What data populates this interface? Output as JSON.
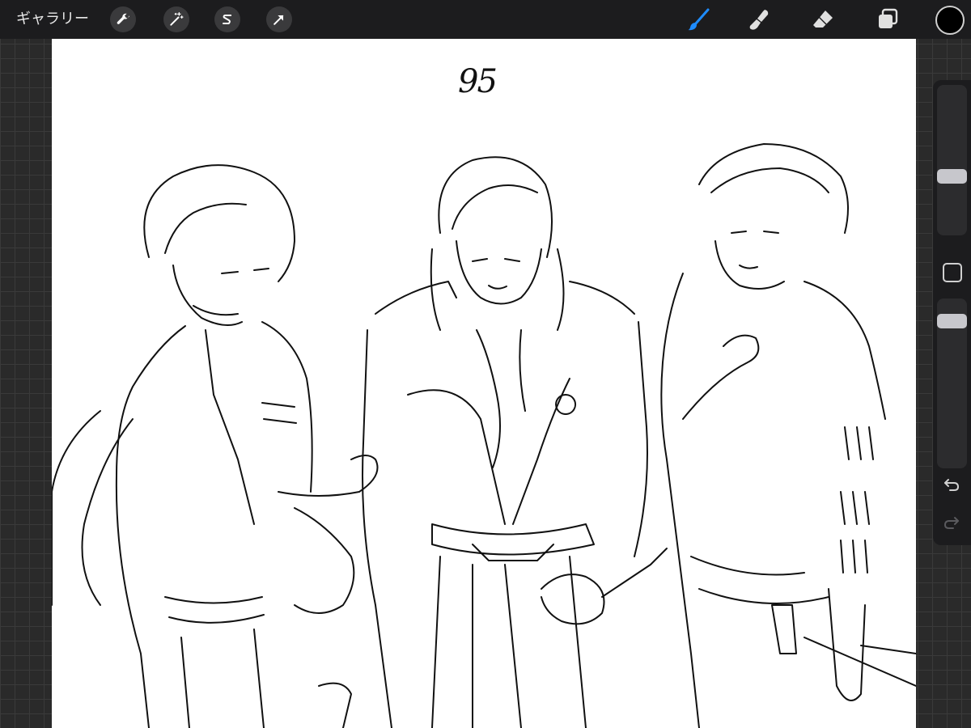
{
  "topbar": {
    "gallery_label": "ギャラリー",
    "actions": [
      {
        "name": "wrench-icon"
      },
      {
        "name": "magic-wand-icon"
      },
      {
        "name": "selection-s-icon"
      },
      {
        "name": "transform-arrow-icon"
      }
    ],
    "tools": [
      {
        "name": "brush-icon",
        "active": true
      },
      {
        "name": "smudge-icon",
        "active": false
      },
      {
        "name": "eraser-icon",
        "active": false
      },
      {
        "name": "layers-icon",
        "active": false
      }
    ],
    "current_color": "#000000",
    "accent_color": "#1e8cff"
  },
  "canvas": {
    "page_number": "95",
    "background": "#ffffff"
  },
  "sidebar": {
    "brush_size_level": 0.38,
    "opacity_level": 0.9,
    "modify_icon": "square-icon",
    "undo_icon": "undo-icon",
    "redo_icon": "redo-icon"
  }
}
